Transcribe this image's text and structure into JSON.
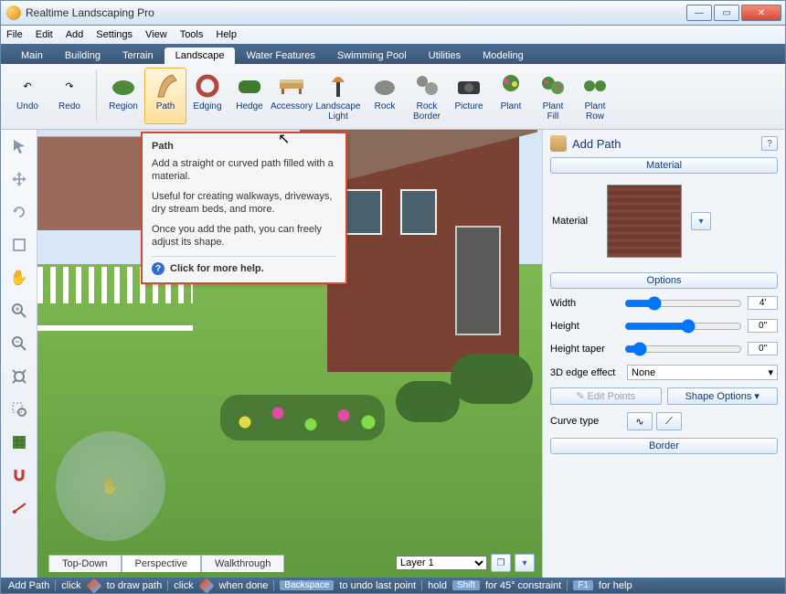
{
  "window": {
    "title": "Realtime Landscaping Pro"
  },
  "menubar": [
    "File",
    "Edit",
    "Add",
    "Settings",
    "View",
    "Tools",
    "Help"
  ],
  "tabs": [
    "Main",
    "Building",
    "Terrain",
    "Landscape",
    "Water Features",
    "Swimming Pool",
    "Utilities",
    "Modeling"
  ],
  "active_tab": "Landscape",
  "ribbon": {
    "undo": "Undo",
    "redo": "Redo",
    "items": [
      {
        "label": "Region"
      },
      {
        "label": "Path"
      },
      {
        "label": "Edging"
      },
      {
        "label": "Hedge"
      },
      {
        "label": "Accessory"
      },
      {
        "label": "Landscape\nLight"
      },
      {
        "label": "Rock"
      },
      {
        "label": "Rock\nBorder"
      },
      {
        "label": "Picture"
      },
      {
        "label": "Plant"
      },
      {
        "label": "Plant\nFill"
      },
      {
        "label": "Plant\nRow"
      }
    ],
    "active_item": "Path"
  },
  "tooltip": {
    "title": "Path",
    "p1": "Add a straight or curved path filled with a material.",
    "p2": "Useful for creating walkways, driveways, dry stream beds, and more.",
    "p3": "Once you add the path, you can freely adjust its shape.",
    "help": "Click for more help."
  },
  "viewtabs": [
    "Top-Down",
    "Perspective",
    "Walkthrough"
  ],
  "active_viewtab": "Perspective",
  "layer": {
    "selected": "Layer 1"
  },
  "rightpanel": {
    "title": "Add Path",
    "section_material": "Material",
    "material_label": "Material",
    "section_options": "Options",
    "width_label": "Width",
    "width_value": "4'",
    "height_label": "Height",
    "height_value": "0\"",
    "taper_label": "Height taper",
    "taper_value": "0\"",
    "edge_label": "3D edge effect",
    "edge_value": "None",
    "editpoints": "Edit Points",
    "shapeopts": "Shape Options",
    "curvetype_label": "Curve type",
    "section_border": "Border"
  },
  "statusbar": {
    "mode": "Add Path",
    "s1a": "click",
    "s1b": "to draw path",
    "s2a": "click",
    "s2b": "when done",
    "k1": "Backspace",
    "k1b": "to undo last point",
    "hold": "hold",
    "k2": "Shift",
    "k2b": "for 45° constraint",
    "k3": "F1",
    "k3b": "for help"
  }
}
